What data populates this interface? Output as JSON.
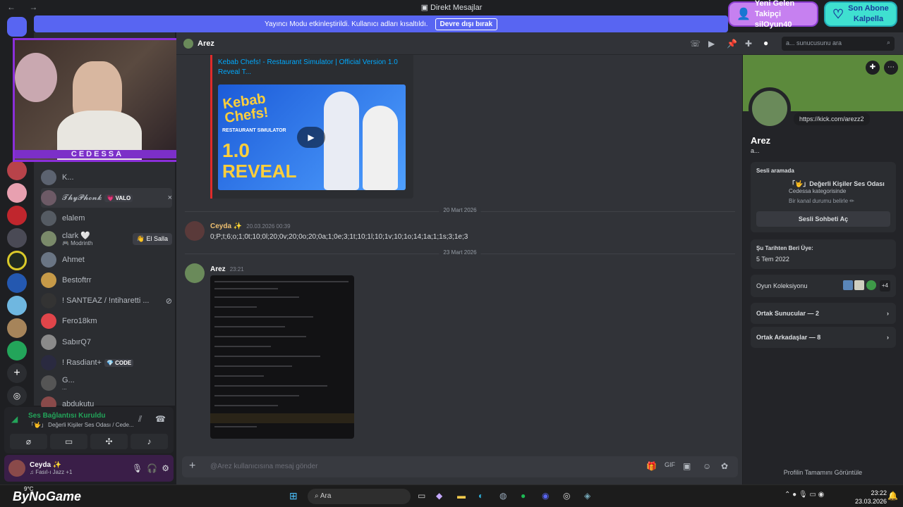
{
  "window": {
    "title": "Direkt Mesajlar",
    "nav": "← →"
  },
  "banner": {
    "text": "Yayıncı Modu etkinleştirildi. Kullanıcı adları kısaltıldı.",
    "button": "Devre dışı bırak"
  },
  "toasts": [
    {
      "line1": "Yeni Gelen Takipçi",
      "line2": "silOyun40"
    },
    {
      "line1": "Son Abone",
      "line2": "Kalpella"
    }
  ],
  "webcam": {
    "label": "CEDESSA"
  },
  "dms": [
    {
      "name": "K...",
      "tag": "",
      "action": "",
      "color": "#5c6370"
    },
    {
      "name": "𝓣𝓱𝔂𝓟𝓱𝓸𝓷𝓴",
      "tag": "💗 VALO",
      "action": "×",
      "color": "#6d5a66"
    },
    {
      "name": "elalem",
      "tag": "",
      "action": "",
      "color": "#555b63"
    },
    {
      "name": "clark 🤍",
      "sub": "🎮 Modrinth",
      "tag": "",
      "action": "👋 El Salla",
      "color": "#7a8a6a"
    },
    {
      "name": "Ahmet",
      "tag": "",
      "action": "",
      "color": "#6a7584"
    },
    {
      "name": "Bestoftrr",
      "tag": "",
      "action": "",
      "color": "#c69a48"
    },
    {
      "name": "! SANTEAZ / !ntiharetti ...",
      "tag": "",
      "action": "⊘",
      "color": "#333"
    },
    {
      "name": "Fero18km",
      "tag": "",
      "action": "",
      "color": "#e0454a"
    },
    {
      "name": "SabırQ7",
      "tag": "",
      "action": "",
      "color": "#8a8a8a"
    },
    {
      "name": "! Rasdiant+",
      "tag": "💎 CODE",
      "action": "",
      "color": "#2a2a40"
    },
    {
      "name": "G...",
      "sub": "...",
      "tag": "",
      "action": "",
      "color": "#555"
    },
    {
      "name": "abdukutu",
      "tag": "",
      "action": "",
      "color": "#8a4a4a"
    }
  ],
  "voice": {
    "status": "Ses Bağlantısı Kuruldu",
    "channel": "「🤟」 Değerli Kişiler Ses Odası / Cede..."
  },
  "user": {
    "name": "Ceyda ✨",
    "status": "♫ Fasıl-ı Jazz +1"
  },
  "chat": {
    "recipient": "Arez",
    "search_placeholder": "a... sunucusunu ara",
    "embed_title": "Kebab Chefs! - Restaurant Simulator | Official Version 1.0 Reveal T...",
    "thumb": {
      "line1": "Kebab",
      "line2": "Chefs!",
      "line3": "RESTAURANT SIMULATOR",
      "big1": "1.0",
      "big2": "REVEAL"
    },
    "date1": "20 Mart 2026",
    "msg1": {
      "author": "Ceyda ✨",
      "time": "20.03.2026 00:39",
      "text": "0;P;t;6;o;1;0t;10;0l;20;0v;20;0o;20;0a;1;0e;3;1t;10;1l;10;1v;10;1o;14;1a;1;1s;3;1e;3"
    },
    "date2": "23 Mart 2026",
    "msg2": {
      "author": "Arez",
      "time": "23:21"
    },
    "composer_placeholder": "@Arez kullanıcısına mesaj gönder"
  },
  "profile": {
    "name": "Arez",
    "handle": "a...",
    "link": "https://kick.com/arezz2",
    "voice_label": "Sesli aramada",
    "voice_channel": "「🤟」Değerli Kişiler Ses Odası",
    "voice_cat": "Cedessa kategorisinde",
    "voice_hint": "Bir kanal durumu belirle ✏",
    "voice_btn": "Sesli Sohbeti Aç",
    "member_label": "Şu Tarihten Beri Üye:",
    "member_date": "5 Tem 2022",
    "games": "Oyun Koleksiyonu",
    "games_more": "+4",
    "mutual_servers": "Ortak Sunucular — 2",
    "mutual_friends": "Ortak Arkadaşlar — 8",
    "full": "Profilin Tamamını Görüntüle"
  },
  "taskbar": {
    "search": "Ara",
    "time": "23:22",
    "date": "23.03.2026",
    "weather": "9°C",
    "watermark": "ByNoGame"
  },
  "colors": {
    "accent": "#5865f2",
    "bg": "#313338",
    "green": "#23a55a"
  }
}
